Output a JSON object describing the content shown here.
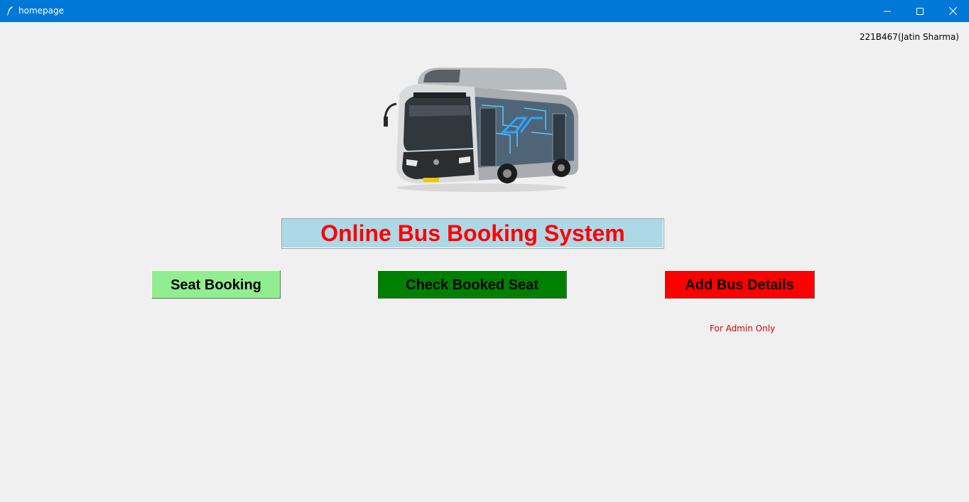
{
  "window": {
    "title": "homepage",
    "controls": [
      "minimize",
      "maximize",
      "close"
    ]
  },
  "header": {
    "user": "221B467(Jatin Sharma)"
  },
  "hero": {
    "image_icon": "bus-image"
  },
  "main": {
    "title": "Online Bus Booking System",
    "title_color": "#ff0000",
    "title_bg": "#add8e6"
  },
  "buttons": {
    "seat_booking": {
      "label": "Seat Booking",
      "color": "#90ee90"
    },
    "check_booked": {
      "label": "Check Booked Seat",
      "color": "#008000"
    },
    "add_bus": {
      "label": "Add Bus Details",
      "color": "#ff0000"
    }
  },
  "notes": {
    "admin": "For Admin Only"
  }
}
